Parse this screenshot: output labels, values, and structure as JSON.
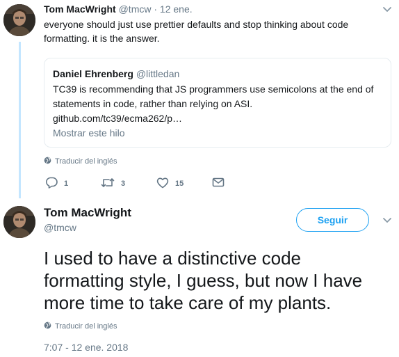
{
  "reply_tweet": {
    "name": "Tom MacWright",
    "handle": "@tmcw",
    "separator": " · ",
    "date": "12 ene.",
    "text_line1": "everyone should just use prettier defaults and stop thinking about code",
    "text_line2": "formatting. it is the answer.",
    "quoted": {
      "name": "Daniel Ehrenberg",
      "handle": "@littledan",
      "text_line1": "TC39 is recommending that JS programmers use semicolons at the end of",
      "text_line2": "statements in code, rather than relying on ASI.",
      "link": "github.com/tc39/ecma262/p…",
      "show_thread": "Mostrar este hilo"
    },
    "translate_label": "Traducir del inglés",
    "actions": {
      "reply_count": "1",
      "retweet_count": "3",
      "like_count": "15"
    }
  },
  "main_tweet": {
    "name": "Tom MacWright",
    "handle": "@tmcw",
    "follow_label": "Seguir",
    "text_line1": "I used to have a distinctive code",
    "text_line2": "formatting style, I guess, but now I have",
    "text_line3": "more time to take care of my plants.",
    "translate_label": "Traducir del inglés",
    "timestamp": "7:07 - 12 ene. 2018"
  },
  "colors": {
    "accent": "#1da1f2",
    "thread_line": "#c4e6ff",
    "muted": "#657786",
    "text": "#14171a"
  },
  "icons": [
    "chevron-down-icon",
    "globe-icon",
    "reply-icon",
    "retweet-icon",
    "heart-icon",
    "envelope-icon"
  ]
}
